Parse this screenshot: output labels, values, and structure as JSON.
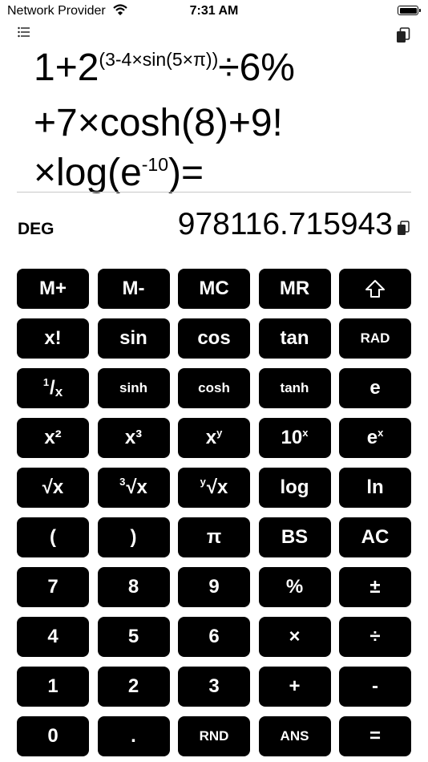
{
  "status_bar": {
    "carrier": "Network Provider",
    "time": "7:31 AM"
  },
  "expression": {
    "line1_prefix": "1+2",
    "line1_exponent": "(3-4×sin(5×π))",
    "line1_suffix": "÷6%",
    "line2": "+7×cosh(8)+9!",
    "line3_prefix": "×log(e",
    "line3_exponent": "-10",
    "line3_suffix": ")="
  },
  "mode": "DEG",
  "result": "978116.715943",
  "icons": {
    "history": "list-icon",
    "copy": "copy-icon",
    "shift": "shift-arrow-icon",
    "wifi": "wifi-icon",
    "battery": "battery-icon"
  },
  "keys": {
    "m_plus": "M+",
    "m_minus": "M-",
    "mc": "MC",
    "mr": "MR",
    "fact": "x!",
    "sin": "sin",
    "cos": "cos",
    "tan": "tan",
    "rad": "RAD",
    "recip_num": "1",
    "recip_slash": "/",
    "recip_den": "x",
    "sinh": "sinh",
    "cosh": "cosh",
    "tanh": "tanh",
    "e": "e",
    "x2": "x²",
    "x3": "x³",
    "xy_base": "x",
    "xy_exp": "y",
    "tenx_base": "10",
    "tenx_exp": "x",
    "ex_base": "e",
    "ex_exp": "x",
    "sqrt": "√x",
    "cbrt_idx": "3",
    "cbrt_body": "√x",
    "yroot_idx": "y",
    "yroot_body": "√x",
    "log": "log",
    "ln": "ln",
    "lparen": "(",
    "rparen": ")",
    "pi": "π",
    "bs": "BS",
    "ac": "AC",
    "d7": "7",
    "d8": "8",
    "d9": "9",
    "percent": "%",
    "plusminus": "±",
    "d4": "4",
    "d5": "5",
    "d6": "6",
    "multiply": "×",
    "divide": "÷",
    "d1": "1",
    "d2": "2",
    "d3": "3",
    "plus": "+",
    "minus": "-",
    "d0": "0",
    "dot": ".",
    "rnd": "RND",
    "ans": "ANS",
    "equals": "="
  }
}
